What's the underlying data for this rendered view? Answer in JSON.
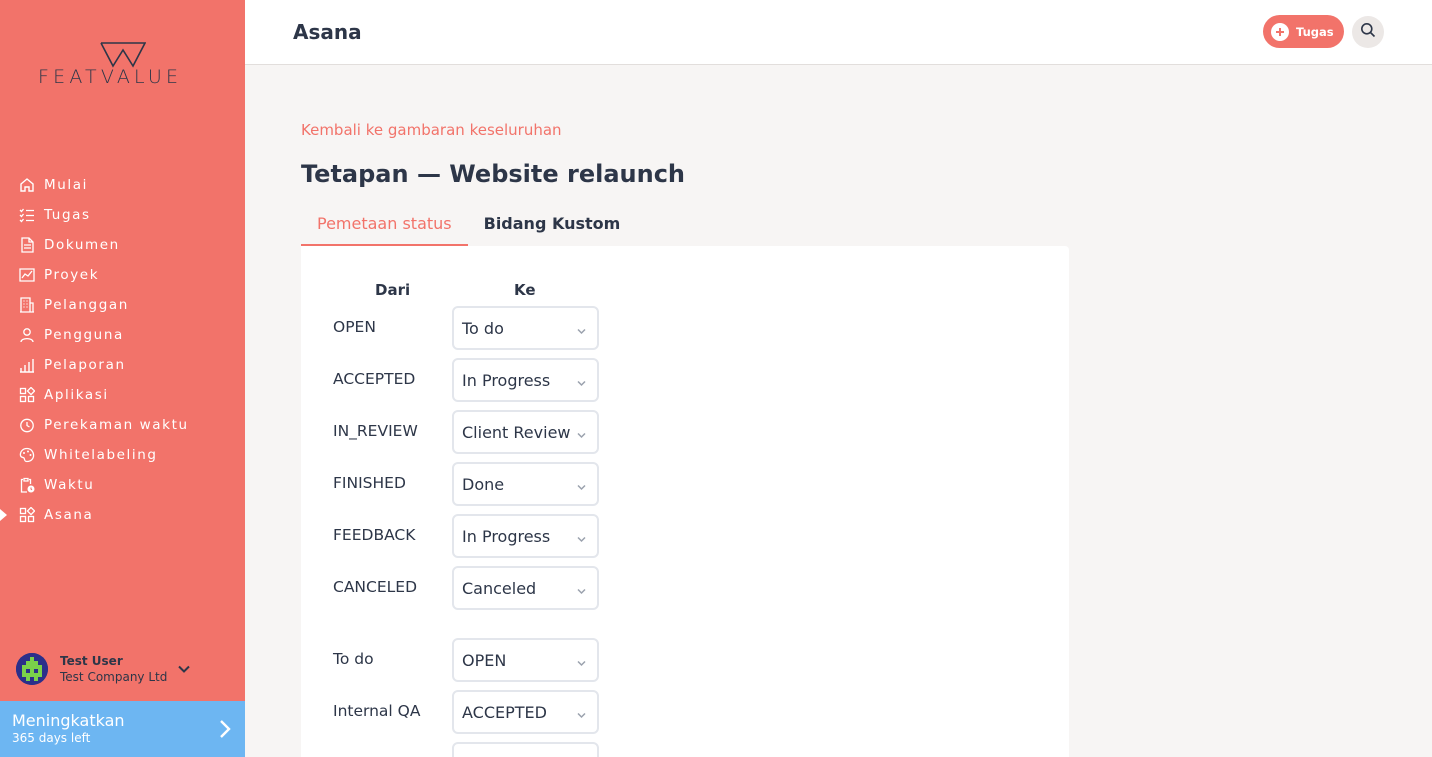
{
  "app": {
    "logo_text": "FEATVALUE"
  },
  "sidebar": {
    "items": [
      {
        "label": "Mulai",
        "icon": "home-icon"
      },
      {
        "label": "Tugas",
        "icon": "tasks-icon"
      },
      {
        "label": "Dokumen",
        "icon": "document-icon"
      },
      {
        "label": "Proyek",
        "icon": "project-chart-icon"
      },
      {
        "label": "Pelanggan",
        "icon": "building-icon"
      },
      {
        "label": "Pengguna",
        "icon": "user-icon"
      },
      {
        "label": "Pelaporan",
        "icon": "bar-chart-icon"
      },
      {
        "label": "Aplikasi",
        "icon": "apps-grid-icon"
      },
      {
        "label": "Perekaman waktu",
        "icon": "timer-icon"
      },
      {
        "label": "Whitelabeling",
        "icon": "palette-icon"
      },
      {
        "label": "Waktu",
        "icon": "clipboard-clock-icon"
      },
      {
        "label": "Asana",
        "icon": "apps-grid-icon"
      }
    ],
    "active_item": "Asana",
    "user": {
      "name": "Test User",
      "company": "Test Company Ltd"
    },
    "upgrade": {
      "title": "Meningkatkan",
      "subtitle": "365 days left"
    }
  },
  "header": {
    "title": "Asana",
    "add_button_label": "Tugas"
  },
  "main": {
    "back_link": "Kembali ke gambaran keseluruhan",
    "title": "Tetapan — Website relaunch",
    "tabs": [
      {
        "label": "Pemetaan status",
        "active": true
      },
      {
        "label": "Bidang Kustom",
        "active": false
      }
    ],
    "mapping": {
      "from_header": "Dari",
      "to_header": "Ke",
      "rows": [
        {
          "from": "OPEN",
          "to": "To do"
        },
        {
          "from": "ACCEPTED",
          "to": "In Progress"
        },
        {
          "from": "IN_REVIEW",
          "to": "Client Review"
        },
        {
          "from": "FINISHED",
          "to": "Done"
        },
        {
          "from": "FEEDBACK",
          "to": "In Progress"
        },
        {
          "from": "CANCELED",
          "to": "Canceled"
        }
      ],
      "reverse_rows": [
        {
          "from": "To do",
          "to": "OPEN"
        },
        {
          "from": "Internal QA",
          "to": "ACCEPTED"
        },
        {
          "from": "",
          "to": ""
        }
      ]
    }
  },
  "colors": {
    "brand": "#f2736a",
    "upgrade": "#6db6f2",
    "text": "#2d3648",
    "background": "#f7f5f4"
  }
}
